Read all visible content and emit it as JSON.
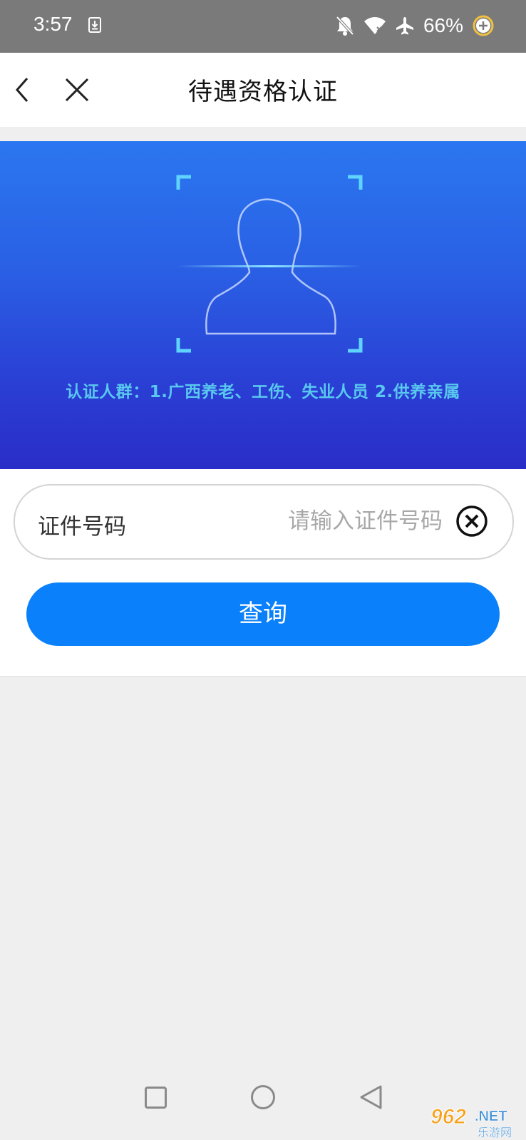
{
  "status_bar": {
    "time": "3:57",
    "battery": "66%",
    "icons": [
      "download-icon",
      "bell-off-icon",
      "wifi-icon",
      "airplane-icon",
      "battery-saver-icon"
    ]
  },
  "nav": {
    "title": "待遇资格认证",
    "back_icon": "chevron-left-icon",
    "close_icon": "close-icon"
  },
  "banner": {
    "caption": "认证人群：1.广西养老、工伤、失业人员    2.供养亲属",
    "colors": {
      "top": "#2b77f0",
      "bottom": "#2a2dc8",
      "accent": "#59c8ef"
    }
  },
  "form": {
    "id_label": "证件号码",
    "id_value": "",
    "id_placeholder": "请输入证件号码",
    "clear_icon": "clear-circle-icon",
    "query_label": "查询",
    "button_color": "#0a80fb"
  },
  "system_nav": {
    "icons": [
      "recent-apps-icon",
      "home-icon",
      "back-triangle-icon"
    ]
  },
  "watermark": {
    "brand": "962.NET",
    "sub": "乐游网"
  }
}
